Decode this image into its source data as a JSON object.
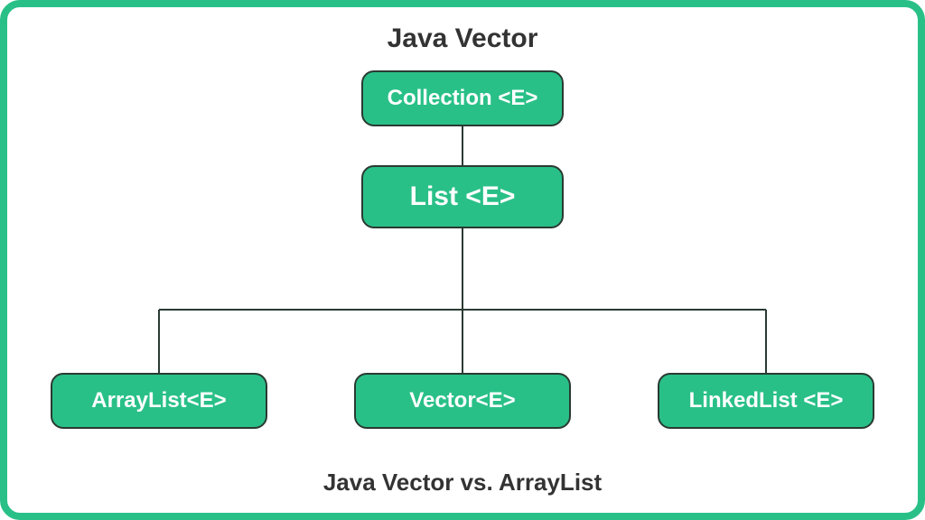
{
  "title": "Java Vector",
  "caption": "Java Vector vs. ArrayList",
  "colors": {
    "accent": "#29c088",
    "border": "#2a3a32",
    "text": "#333",
    "node_text": "#ffffff"
  },
  "nodes": {
    "collection": {
      "label": "Collection <E>"
    },
    "list": {
      "label": "List <E>"
    },
    "arraylist": {
      "label": "ArrayList<E>"
    },
    "vector": {
      "label": "Vector<E>"
    },
    "linkedlist": {
      "label": "LinkedList <E>"
    }
  },
  "hierarchy": {
    "root": "collection",
    "children": {
      "collection": [
        "list"
      ],
      "list": [
        "arraylist",
        "vector",
        "linkedlist"
      ]
    }
  }
}
